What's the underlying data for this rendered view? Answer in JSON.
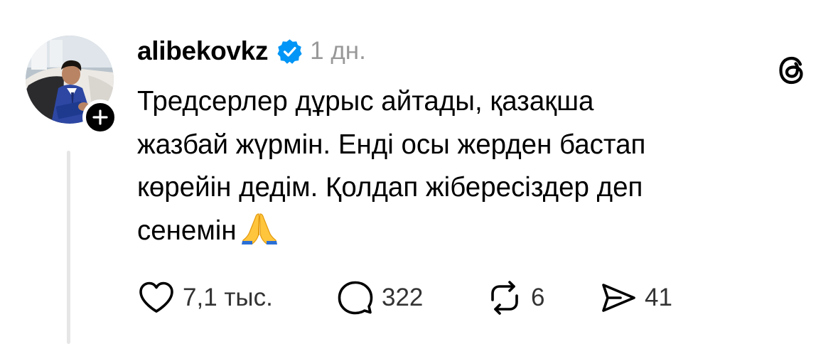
{
  "post": {
    "username": "alibekovkz",
    "timestamp": "1 дн.",
    "verified": true,
    "text_lines": [
      "Тредсерлер дұрыс айтады, қазақша",
      "жазбай жүрмін. Енді осы жерден бастап",
      "көрейін дедім. Қолдап жібересіздер деп",
      "сенемін"
    ],
    "emoji": "folded-hands"
  },
  "actions": {
    "likes": "7,1 тыс.",
    "comments": "322",
    "reposts": "6",
    "shares": "41"
  },
  "colors": {
    "text": "#000000",
    "muted": "#999999",
    "verified": "#0095f6",
    "thread_line": "#e6e6e6"
  },
  "icons": [
    "plus-icon",
    "verified-badge-icon",
    "threads-logo-icon",
    "heart-icon",
    "comment-icon",
    "repost-icon",
    "share-icon"
  ]
}
